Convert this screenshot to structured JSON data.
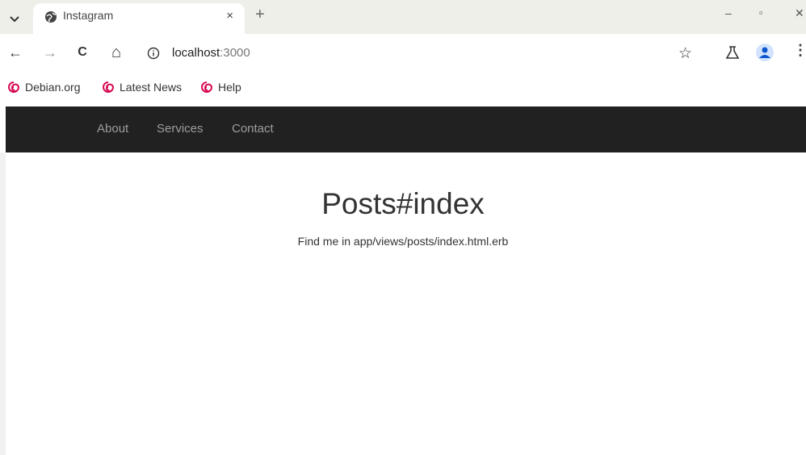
{
  "browser": {
    "tab": {
      "title": "Instagram",
      "close_glyph": "×"
    },
    "new_tab_glyph": "+",
    "window_controls": {
      "minimize": "–",
      "maximize": "▫",
      "close": "✕"
    },
    "nav": {
      "back": "←",
      "forward": "→",
      "reload": "C",
      "home": "⌂"
    },
    "address": {
      "host": "localhost",
      "port": ":3000"
    },
    "bookmark_star": "☆",
    "bookmarks": [
      {
        "label": "Debian.org"
      },
      {
        "label": "Latest News"
      },
      {
        "label": "Help"
      }
    ],
    "menu_glyph": "⋮",
    "icons": [
      "tab-search-icon",
      "globe-icon",
      "info-icon",
      "star-icon",
      "labs-icon",
      "profile-icon",
      "debian-icon"
    ]
  },
  "page": {
    "navbar": {
      "links": [
        "About",
        "Services",
        "Contact"
      ]
    },
    "heading": "Posts#index",
    "text": "Find me in app/views/posts/index.html.erb"
  },
  "colors": {
    "navbar_bg": "#212121",
    "navbar_link": "#9d9d9d",
    "tabstrip_bg": "#eeefe9",
    "debian_red": "#d70a53"
  }
}
